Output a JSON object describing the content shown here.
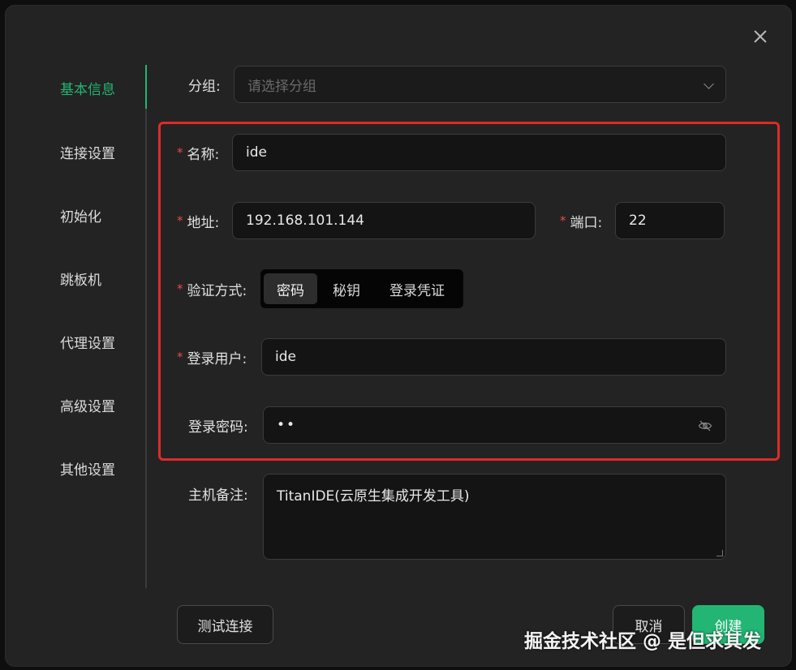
{
  "nav": {
    "items": [
      {
        "label": "基本信息",
        "active": true
      },
      {
        "label": "连接设置",
        "active": false
      },
      {
        "label": "初始化",
        "active": false
      },
      {
        "label": "跳板机",
        "active": false
      },
      {
        "label": "代理设置",
        "active": false
      },
      {
        "label": "高级设置",
        "active": false
      },
      {
        "label": "其他设置",
        "active": false
      }
    ]
  },
  "form": {
    "group": {
      "label": "分组:",
      "placeholder": "请选择分组"
    },
    "name": {
      "label": "名称:",
      "value": "ide"
    },
    "address": {
      "label": "地址:",
      "value": "192.168.101.144"
    },
    "port": {
      "label": "端口:",
      "value": "22"
    },
    "auth": {
      "label": "验证方式:",
      "options": [
        "密码",
        "秘钥",
        "登录凭证"
      ],
      "selected": "密码"
    },
    "user": {
      "label": "登录用户:",
      "value": "ide"
    },
    "password": {
      "label": "登录密码:",
      "value": "••"
    },
    "remark": {
      "label": "主机备注:",
      "value": "TitanIDE(云原生集成开发工具)"
    }
  },
  "buttons": {
    "test": "测试连接",
    "cancel": "取消",
    "create": "创建"
  },
  "watermark": "掘金技术社区 @ 是但求其发",
  "colors": {
    "accent": "#22b573",
    "required": "#e84a4a",
    "highlight": "#e02a2a"
  }
}
